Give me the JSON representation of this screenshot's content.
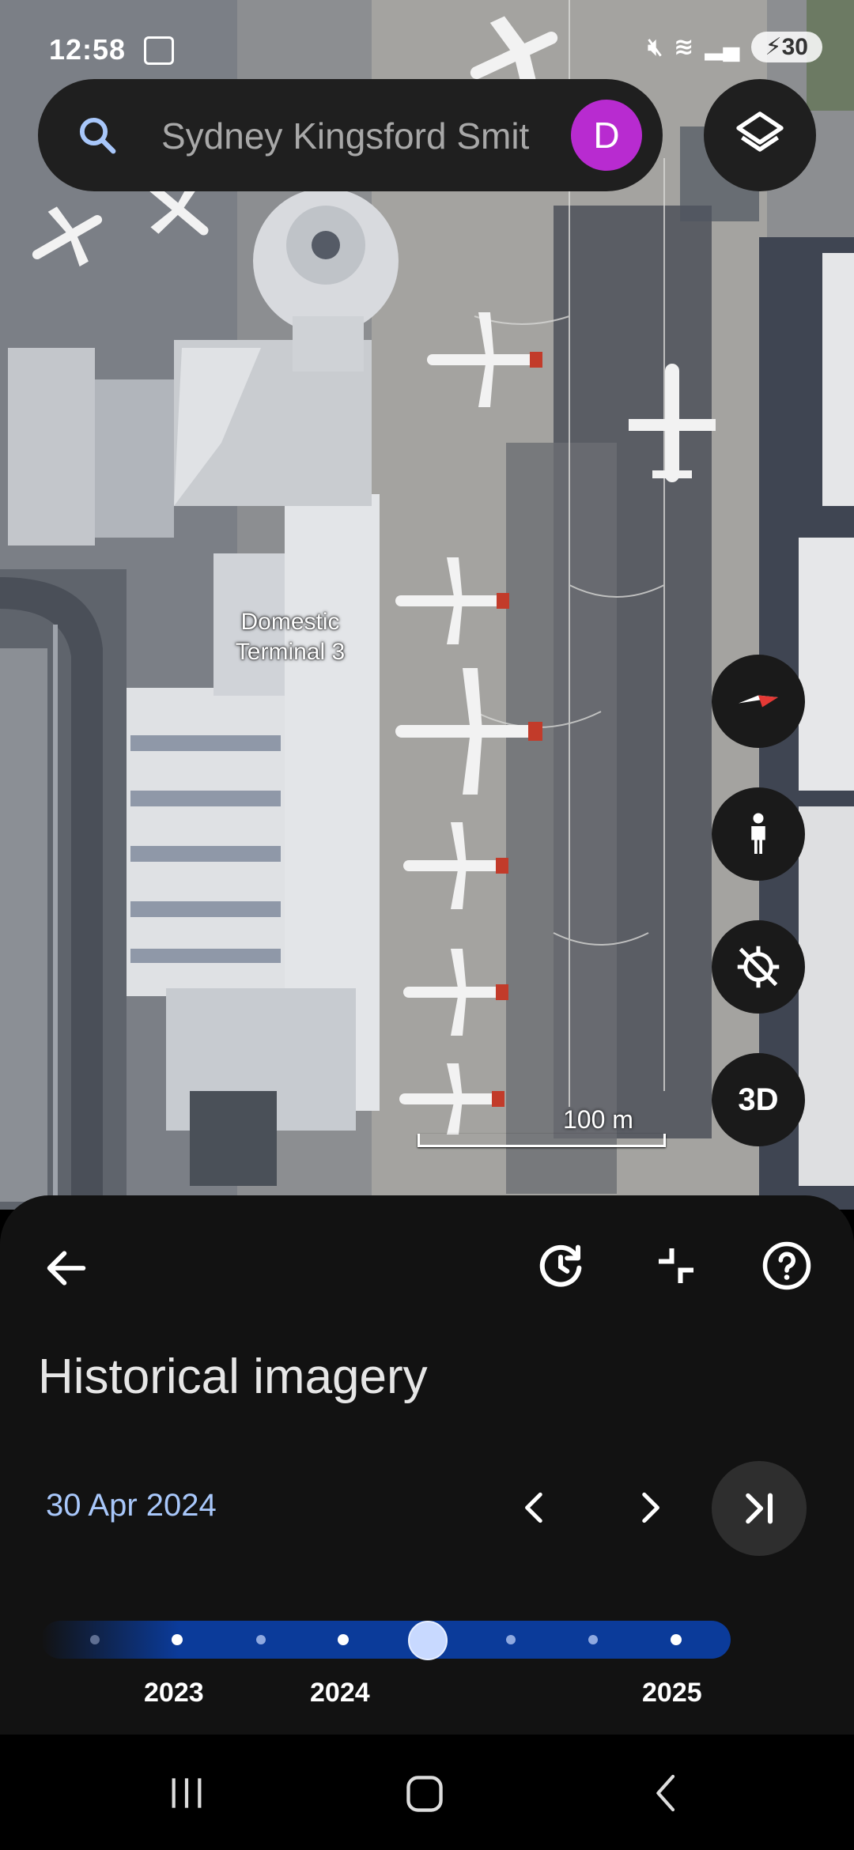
{
  "status_bar": {
    "time": "12:58",
    "battery": "30"
  },
  "search": {
    "placeholder": "Sydney Kingsford Smit",
    "avatar_letter": "D"
  },
  "map": {
    "label_line1": "Domestic",
    "label_line2": "Terminal 3",
    "scale": "100 m"
  },
  "fab": {
    "threed_label": "3D"
  },
  "sheet": {
    "title": "Historical imagery",
    "date": "30 Apr 2024",
    "timeline_labels": [
      "2023",
      "2024",
      "2025"
    ]
  },
  "colors": {
    "accent_date": "#a8c7fa",
    "timeline": "#0b3b9a",
    "avatar": "#b82bd0"
  }
}
